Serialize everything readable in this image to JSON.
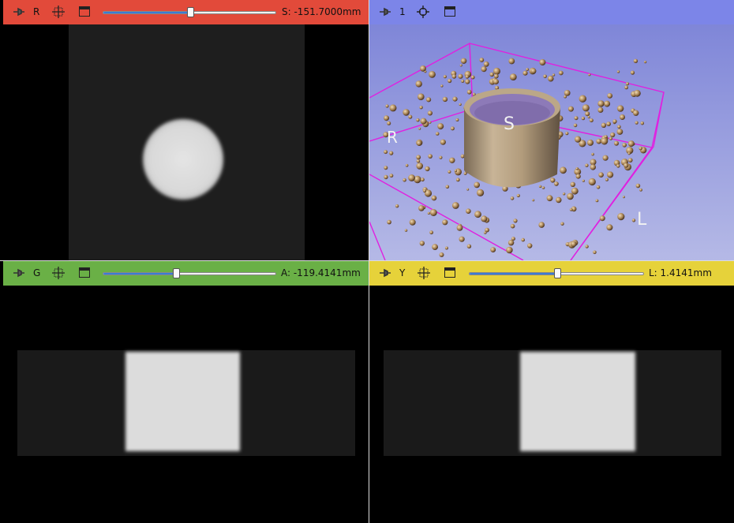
{
  "views": {
    "red": {
      "letter": "R",
      "value": "S: -151.7000mm",
      "slider_fraction": 0.5,
      "color": "#e24a3a"
    },
    "three_d": {
      "letter": "1",
      "color": "#7c85e8"
    },
    "green": {
      "letter": "G",
      "value": "A: -119.4141mm",
      "slider_fraction": 0.41,
      "color": "#6ab046"
    },
    "yellow": {
      "letter": "Y",
      "value": "L: 1.4141mm",
      "slider_fraction": 0.5,
      "color": "#e6d23a"
    }
  },
  "orientation_labels": {
    "r": "R",
    "s": "S",
    "l": "L"
  },
  "icons": {
    "pin": "pin-icon",
    "crosshair": "crosshair-icon",
    "window": "maximize-icon"
  }
}
